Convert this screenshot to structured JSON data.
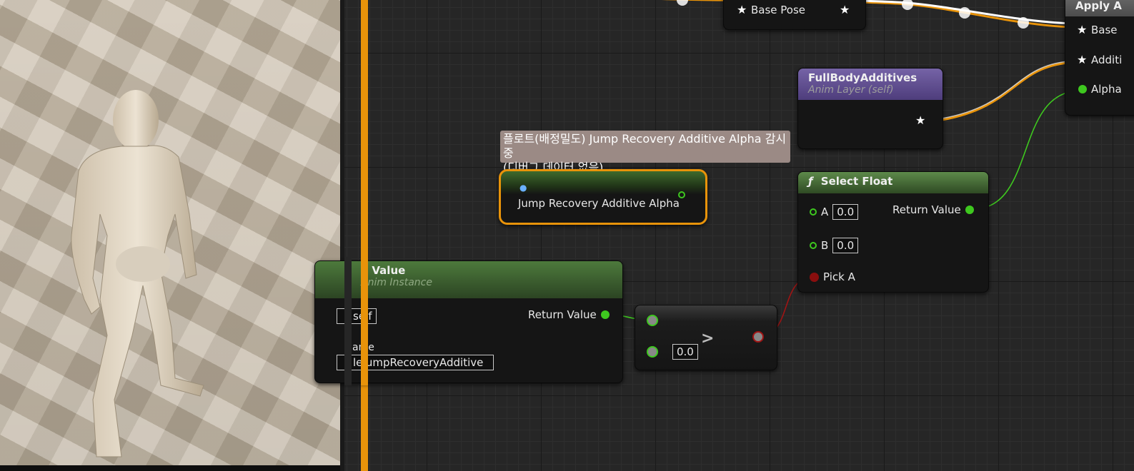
{
  "tooltip": {
    "line1": "플로트(배정밀도) Jump Recovery Additive Alpha 감시중",
    "line2": "(디버그 데이터 없음)"
  },
  "nodes": {
    "apply_additive": {
      "title": "Apply A",
      "pins": [
        "Base",
        "Additi",
        "Alpha"
      ]
    },
    "base_pose": {
      "label": "Base Pose"
    },
    "full_body_additives": {
      "title": "FullBodyAdditives",
      "subtitle": "Anim Layer (self)"
    },
    "variable_get": {
      "label": "Jump Recovery Additive Alpha"
    },
    "select_float": {
      "icon": "ƒ",
      "title": "Select Float",
      "pin_a_label": "A",
      "pin_a_value": "0.0",
      "pin_b_label": "B",
      "pin_b_value": "0.0",
      "pick_a_label": "Pick A",
      "return_label": "Return Value"
    },
    "get_curve_value": {
      "title": "e Value",
      "subtitle": "Anim Instance",
      "return_label": "Return Value",
      "target_value": "self",
      "name_label": "ame",
      "name_value": "leJumpRecoveryAdditive"
    },
    "greater": {
      "symbol": ">",
      "b_value": "0.0"
    }
  },
  "colors": {
    "exec_wire": "#e8930a",
    "float_pin": "#3ec81f",
    "bool_pin": "#a01414",
    "pose_wire": "#ffffff",
    "anim_layer_header": "#5b4a8a",
    "pure_function_header": "#4d7a3c",
    "selection_outline": "#e8930a",
    "tooltip_bg": "#9b8a85"
  }
}
